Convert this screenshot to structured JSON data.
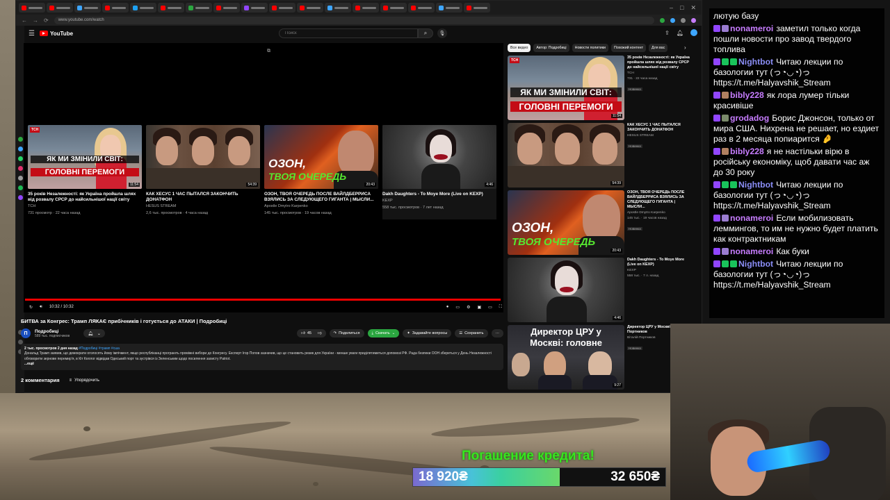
{
  "browser": {
    "url": "www.youtube.com/watch"
  },
  "youtube": {
    "logo_text": "YouTube",
    "search_placeholder": "Поиск"
  },
  "player": {
    "time": "10:32 / 10:32",
    "progress": 1.0,
    "endscreen": [
      {
        "title": "35 років Незалежності: як Україна пройшла шлях від розвалу СРСР до найсильнішої нації світу",
        "channel": "ТСН",
        "meta": "731 просмотр · 22 часа назад",
        "duration": "11:54",
        "caption": "ЯК МИ ЗМІНИЛИ СВІТ:",
        "caption2": "ГОЛОВНІ ПЕРЕМОГИ",
        "badge": "ТСН"
      },
      {
        "title": "КАК ХЕСУС 1 ЧАС ПЫТАЛСЯ ЗАКОНЧИТЬ ДОНАТФОН",
        "channel": "HESUS STREAM",
        "meta": "2,6 тыс. просмотров · 4 часа назад",
        "duration": "54:39"
      },
      {
        "title": "ОЗОН, ТВОЯ ОЧЕРЕДЬ ПОСЛЕ ВАЙЛДБЕРРИСА ВЗЯЛИСЬ ЗА СЛЕДУЮЩЕГО ГИГАНТА | МЫСЛИ...",
        "channel": "Apostle Dmytro Karpenko",
        "meta": "145 тыс. просмотров · 19 часов назад",
        "duration": "20:43",
        "caption": "ОЗОН,",
        "caption2": "ТВОЯ ОЧЕРЕДЬ"
      },
      {
        "title": "Dakh Daughters - To Moye More (Live on KEXP)",
        "channel": "KEXP",
        "meta": "558 тыс. просмотров · 7 лет назад",
        "duration": "4:46"
      }
    ]
  },
  "video": {
    "title": "БИТВА за Конгрес: Трамп ЛЯКАЄ прибічників і готується до АТАКИ | Подробиці",
    "channel_name": "Подробиці",
    "channel_subs": "589 тыс. подписчиков",
    "channel_initial": "П",
    "likes": "45",
    "share_label": "Поделиться",
    "download_label": "Скачать",
    "ask_label": "Задавайте вопросы",
    "save_label": "Сохранить",
    "more_label": "···",
    "desc_meta": "2 тыс. просмотров  2 дня назад",
    "desc_tags": "#Подробиці #трамп #сша",
    "desc_text": "Дональд Трамп заявив, що демократи оголосять йому імпічмент, якщо республіканці програють проміжні вибори до Конгресу. Експерт Ігор Попов зазначив, що це становить ризик для України - менше уваги приділятиметься допомозі РФ. Рада безпеки ООН збереться у День Незалежності обговорити зернове перемир'я, в Кіт Келлог відвідав Одеський порт та зустрівся із Зеленським щодо посилення захисту Patriot.",
    "desc_more": "...ещё",
    "comments_count": "2 комментария",
    "sort_label": "Упорядочить"
  },
  "chips": [
    "Все видео",
    "Автор: Подробиці",
    "Новости политики",
    "Похожий контент",
    "Для вас"
  ],
  "recs": [
    {
      "title": "35 років Незалежності: як Україна пройшла шлях від розвалу СРСР до найсильнішої нації світу",
      "channel": "ТСН",
      "meta": "731 · 22 часа назад",
      "badge": "Новинка",
      "duration": "11:54",
      "caption": "ЯК МИ ЗМІНИЛИ СВІТ:",
      "caption2": "ГОЛОВНІ ПЕРЕМОГИ",
      "tsn": "ТСН"
    },
    {
      "title": "КАК ХЕСУС 1 ЧАС ПЫТАЛСЯ ЗАКОНЧИТЬ ДОНАТФОН",
      "channel": "HESUS STREAM",
      "meta": "",
      "badge": "Новинка",
      "duration": "54:39"
    },
    {
      "title": "ОЗОН, ТВОЯ ОЧЕРЕДЬ ПОСЛЕ ВАЙЛДБЕРРИСА ВЗЯЛИСЬ ЗА СЛЕДУЮЩЕГО ГИГАНТА | МЫСЛИ...",
      "channel": "Apostle Dmytro Karpenko",
      "meta": "145 тыс. · 19 часов назад",
      "badge": "Новинка",
      "duration": "20:43",
      "caption": "ОЗОН,",
      "caption2": "ТВОЯ ОЧЕРЕДЬ"
    },
    {
      "title": "Dakh Daughters - To Moye More (Live on KEXP)",
      "channel": "KEXP",
      "meta": "558 тыс. · 7 л. назад",
      "badge": "",
      "duration": "4:46"
    },
    {
      "title": "Директор ЦРУ у Москві: Віталій Портников",
      "channel": "Віталій Портников",
      "meta": "",
      "badge": "Новинка",
      "duration": "9:27",
      "caption": "Директор ЦРУ у",
      "caption2": "Москві: головне"
    }
  ],
  "chat": [
    {
      "user": "",
      "color": "#ffffff",
      "text": "лютую базу",
      "badges": []
    },
    {
      "user": "nonameroi",
      "color": "#c77dff",
      "text": "заметил только когда пошли новости про завод твердого топлива",
      "badges": [
        "#9146ff",
        "#9a7cd0"
      ]
    },
    {
      "user": "Nightbot",
      "color": "#8a8df5",
      "text": "Читаю лекции по базологии тут (っ◔◡◔)っ https://t.me/Halyavshik_Stream",
      "badges": [
        "#9146ff",
        "#19c35b",
        "#19c35b"
      ]
    },
    {
      "user": "bibly228",
      "color": "#c77dff",
      "text": "як лора лумер тільки красивіше",
      "badges": [
        "#9146ff",
        "#b08060"
      ]
    },
    {
      "user": "grodadog",
      "color": "#c77dff",
      "text": "Борис Джонсон, только от мира США. Нихрена не решает, но ездиет раз в 2 месяца попиарится 🤌",
      "badges": [
        "#9146ff",
        "#7a8a6a"
      ]
    },
    {
      "user": "bibly228",
      "color": "#c77dff",
      "text": "я не настільки вірю в російську економіку, щоб давати час аж до 30 року",
      "badges": [
        "#9146ff",
        "#b08060"
      ]
    },
    {
      "user": "Nightbot",
      "color": "#8a8df5",
      "text": "Читаю лекции по базологии тут (っ◔◡◔)っ https://t.me/Halyavshik_Stream",
      "badges": [
        "#9146ff",
        "#19c35b",
        "#19c35b"
      ]
    },
    {
      "user": "nonameroi",
      "color": "#c77dff",
      "text": "Если мобилизовать леммингов, то им не нужно будет платить как контрактникам",
      "badges": [
        "#9146ff",
        "#9a7cd0"
      ]
    },
    {
      "user": "nonameroi",
      "color": "#c77dff",
      "text": "Как буки",
      "badges": [
        "#9146ff",
        "#9a7cd0"
      ]
    },
    {
      "user": "Nightbot",
      "color": "#8a8df5",
      "text": "Читаю лекции по базологии тут (っ◔◡◔)っ https://t.me/Halyavshik_Stream",
      "badges": [
        "#9146ff",
        "#19c35b",
        "#19c35b"
      ]
    }
  ],
  "goal": {
    "title": "Погашение кредита!",
    "current": "18 920₴",
    "target": "32 650₴",
    "progress": 0.58
  }
}
